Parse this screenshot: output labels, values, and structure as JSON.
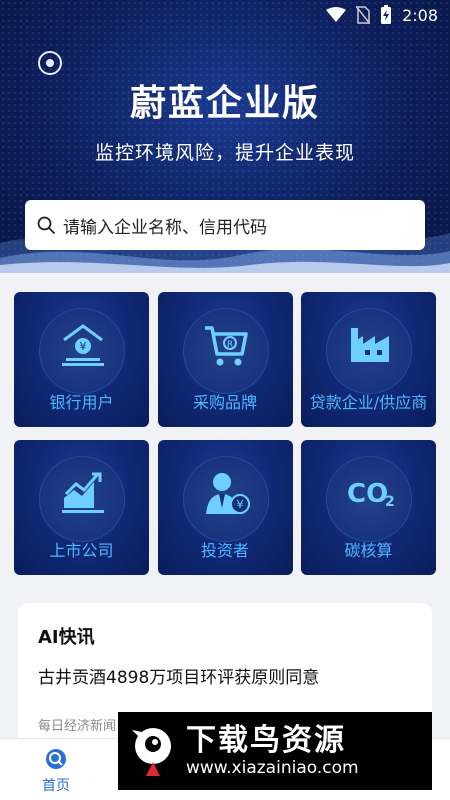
{
  "status_bar": {
    "time": "2:08"
  },
  "header": {
    "title": "蔚蓝企业版",
    "subtitle": "监控环境风险，提升企业表现"
  },
  "search": {
    "placeholder": "请输入企业名称、信用代码"
  },
  "tiles": [
    {
      "label": "银行用户",
      "icon": "bank-icon"
    },
    {
      "label": "采购品牌",
      "icon": "shopping-cart-icon"
    },
    {
      "label": "贷款企业/供应商",
      "icon": "factory-icon"
    },
    {
      "label": "上市公司",
      "icon": "trend-chart-icon"
    },
    {
      "label": "投资者",
      "icon": "investor-icon"
    },
    {
      "label": "碳核算",
      "icon": "co2-icon"
    }
  ],
  "news": {
    "heading": "AI快讯",
    "headline": "古井贡酒4898万项目环评获原则同意",
    "source": "每日经济新闻"
  },
  "bottom_nav": {
    "home_label": "首页"
  },
  "watermark": {
    "title": "下载鸟资源",
    "url": "www.xiazainiao.com"
  },
  "colors": {
    "hero_bg": "#0d1f5c",
    "tile_bg": "#112a78",
    "tile_label": "#4fb6ff",
    "accent": "#2a6fd6"
  }
}
